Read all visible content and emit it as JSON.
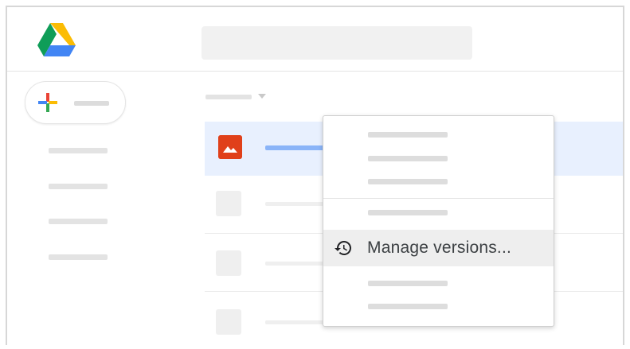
{
  "menu": {
    "manage_versions_label": "Manage versions..."
  },
  "icons": {
    "logo": "google-drive-logo",
    "new": "plus-icon",
    "file": "image-file-icon",
    "history": "history-icon"
  },
  "colors": {
    "selected_row": "#e8f0fe",
    "image_icon": "#e0401a",
    "selected_name": "#8ab4f8",
    "menu_hover": "#eeeeee"
  }
}
